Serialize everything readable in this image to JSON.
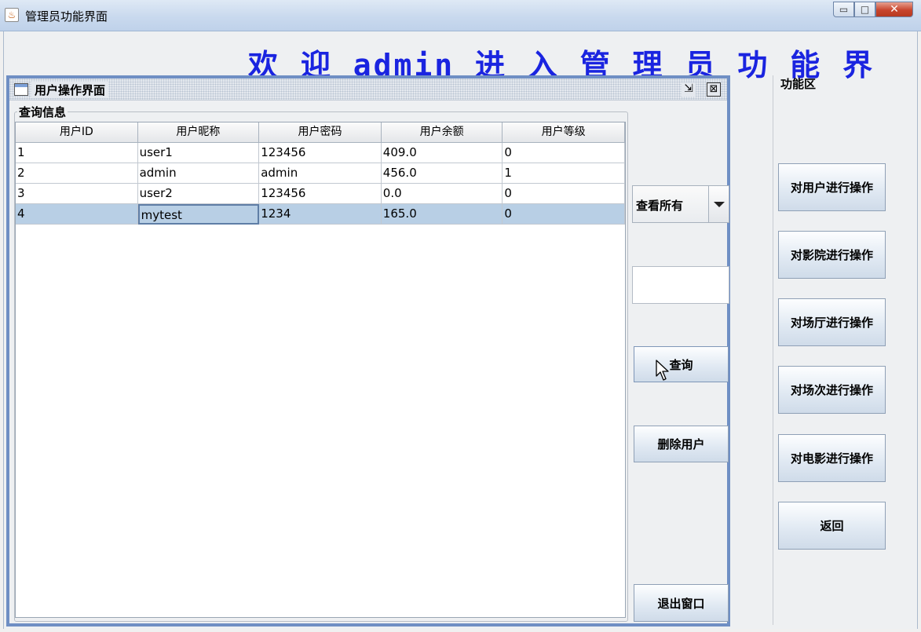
{
  "window": {
    "title": "管理员功能界面",
    "minimize_glyph": "▭",
    "maximize_glyph": "□",
    "close_glyph": "✕"
  },
  "welcome_text": "欢 迎 admin 进 入 管 理 员 功 能 界",
  "internal_frame": {
    "title": "用户操作界面",
    "restore_glyph": "⇲",
    "close_glyph": "⊠"
  },
  "query_group": {
    "label": "查询信息",
    "columns": [
      "用户ID",
      "用户昵称",
      "用户密码",
      "用户余额",
      "用户等级"
    ],
    "rows": [
      [
        "1",
        "user1",
        "123456",
        "409.0",
        "0"
      ],
      [
        "2",
        "admin",
        "admin",
        "456.0",
        "1"
      ],
      [
        "3",
        "user2",
        "123456",
        "0.0",
        "0"
      ],
      [
        "4",
        "mytest",
        "1234",
        "165.0",
        "0"
      ]
    ],
    "selected_row": 4
  },
  "controls": {
    "filter_value": "查看所有",
    "query_input_value": "",
    "query_button": "查询",
    "delete_button": "删除用户",
    "exit_button": "退出窗口"
  },
  "function_area": {
    "label": "功能区",
    "buttons": [
      "对用户进行操作",
      "对影院进行操作",
      "对场厅进行操作",
      "对场次进行操作",
      "对电影进行操作",
      "返回"
    ]
  },
  "colors": {
    "welcome": "#1a24e0",
    "internal_frame_border": "#6f8fc4",
    "selected_row": "#b8cfe5"
  }
}
